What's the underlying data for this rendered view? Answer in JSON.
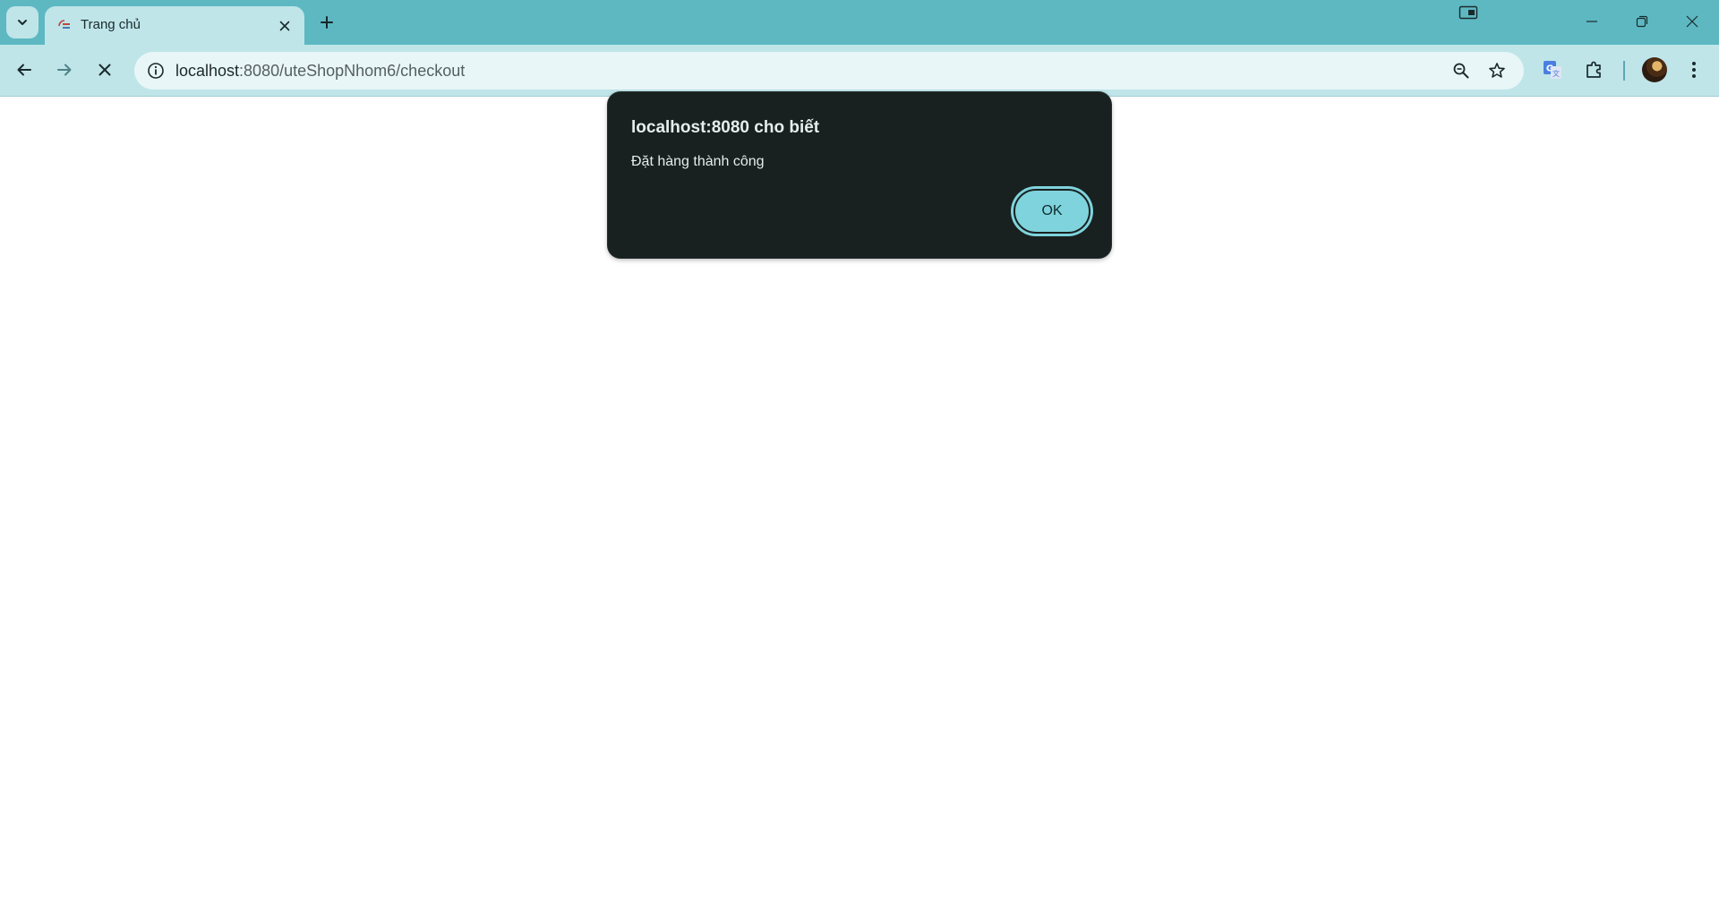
{
  "tab": {
    "title": "Trang chủ"
  },
  "omnibox": {
    "host": "localhost",
    "path": ":8080/uteShopNhom6/checkout"
  },
  "dialog": {
    "title": "localhost:8080 cho biết",
    "message": "Đặt hàng thành công",
    "ok_label": "OK"
  },
  "icons": {
    "tab_search": "chevron-down-icon",
    "tab_close": "close-icon",
    "new_tab": "plus-icon",
    "back": "arrow-left-icon",
    "forward": "arrow-right-icon",
    "stop": "close-icon",
    "site_info": "info-icon",
    "zoom": "zoom-out-icon",
    "bookmark": "star-icon",
    "translate": "google-translate-icon",
    "extensions": "puzzle-icon",
    "menu": "kebab-menu-icon"
  },
  "colors": {
    "tabstrip": "#5db8c2",
    "toolbar": "#bfe5e9",
    "omnibox": "#e8f6f7",
    "dialog_bg": "#182020",
    "ok_button": "#7fd3dc"
  }
}
